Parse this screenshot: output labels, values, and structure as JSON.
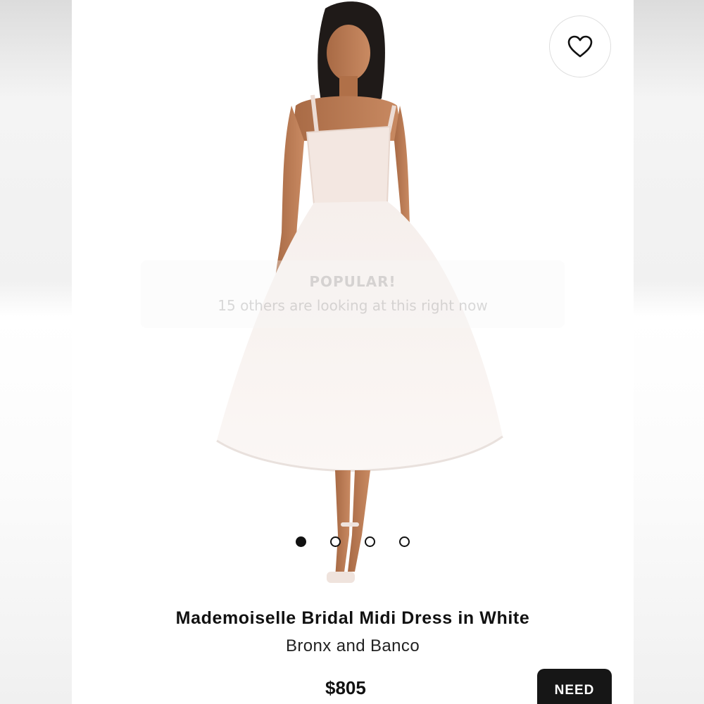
{
  "overlay": {
    "badge": "POPULAR!",
    "message": "15 others are looking at this right now"
  },
  "gallery": {
    "image_count": 4,
    "active_index": 0
  },
  "product": {
    "title": "Mademoiselle Bridal Midi Dress in White",
    "brand": "Bronx and Banco",
    "price": "$805"
  },
  "actions": {
    "need_label": "NEED",
    "favorite_icon": "heart-icon"
  }
}
